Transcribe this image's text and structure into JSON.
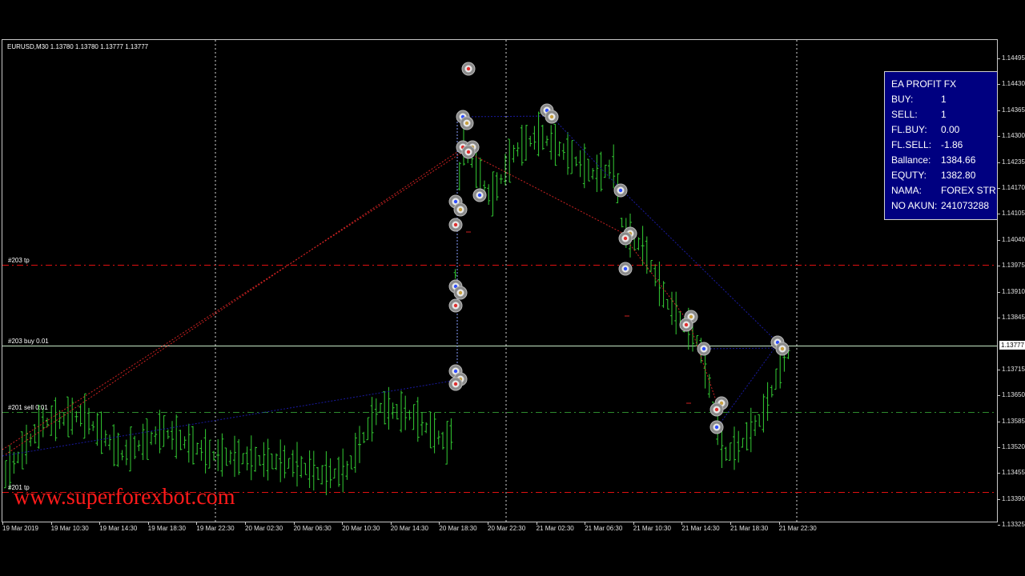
{
  "window": {
    "symbol_line": "EURUSD,M30  1.13780 1.13780 1.13777 1.13777"
  },
  "colors": {
    "background": "#000000",
    "bull_bar": "#33cc33",
    "tp_line": "#e01010",
    "sell_line": "#2e8b2e",
    "buy_line": "#c8e8c8",
    "blue_trade": "#1a1aa0",
    "red_trade": "#cc2222",
    "panel_bg": "#000080",
    "watermark": "#ff1a1a"
  },
  "price_axis": {
    "labels": [
      "1.14495",
      "1.14430",
      "1.14365",
      "1.14300",
      "1.14235",
      "1.14170",
      "1.14105",
      "1.14040",
      "1.13975",
      "1.13910",
      "1.13845",
      "1.13715",
      "1.13650",
      "1.13585",
      "1.13520",
      "1.13455",
      "1.13390",
      "1.13325"
    ],
    "current": "1.13777"
  },
  "time_axis": {
    "labels": [
      "19 Mar 2019",
      "19 Mar 10:30",
      "19 Mar 14:30",
      "19 Mar 18:30",
      "19 Mar 22:30",
      "20 Mar 02:30",
      "20 Mar 06:30",
      "20 Mar 10:30",
      "20 Mar 14:30",
      "20 Mar 18:30",
      "20 Mar 22:30",
      "21 Mar 02:30",
      "21 Mar 06:30",
      "21 Mar 10:30",
      "21 Mar 14:30",
      "21 Mar 18:30",
      "21 Mar 22:30"
    ]
  },
  "order_lines": [
    {
      "label": "#203 tp",
      "price": 1.1398
    },
    {
      "label": "#203 buy 0.01",
      "price": 1.13777
    },
    {
      "label": "#201 sell 0.01",
      "price": 1.13611
    },
    {
      "label": "#201 tp",
      "price": 1.1341
    }
  ],
  "watermark": "www.superforexbot.com",
  "ea_panel": {
    "title": "EA PROFIT FX",
    "rows": [
      {
        "key": "BUY:",
        "value": "1"
      },
      {
        "key": "SELL:",
        "value": "1"
      },
      {
        "key": "FL.BUY:",
        "value": "0.00"
      },
      {
        "key": "FL.SELL:",
        "value": "-1.86"
      },
      {
        "key": "Ballance:",
        "value": "1384.66"
      },
      {
        "key": "EQUTY:",
        "value": "1382.80"
      },
      {
        "key": "NAMA:",
        "value": "FOREX STR"
      },
      {
        "key": "NO AKUN:",
        "value": "241073288"
      }
    ]
  }
}
